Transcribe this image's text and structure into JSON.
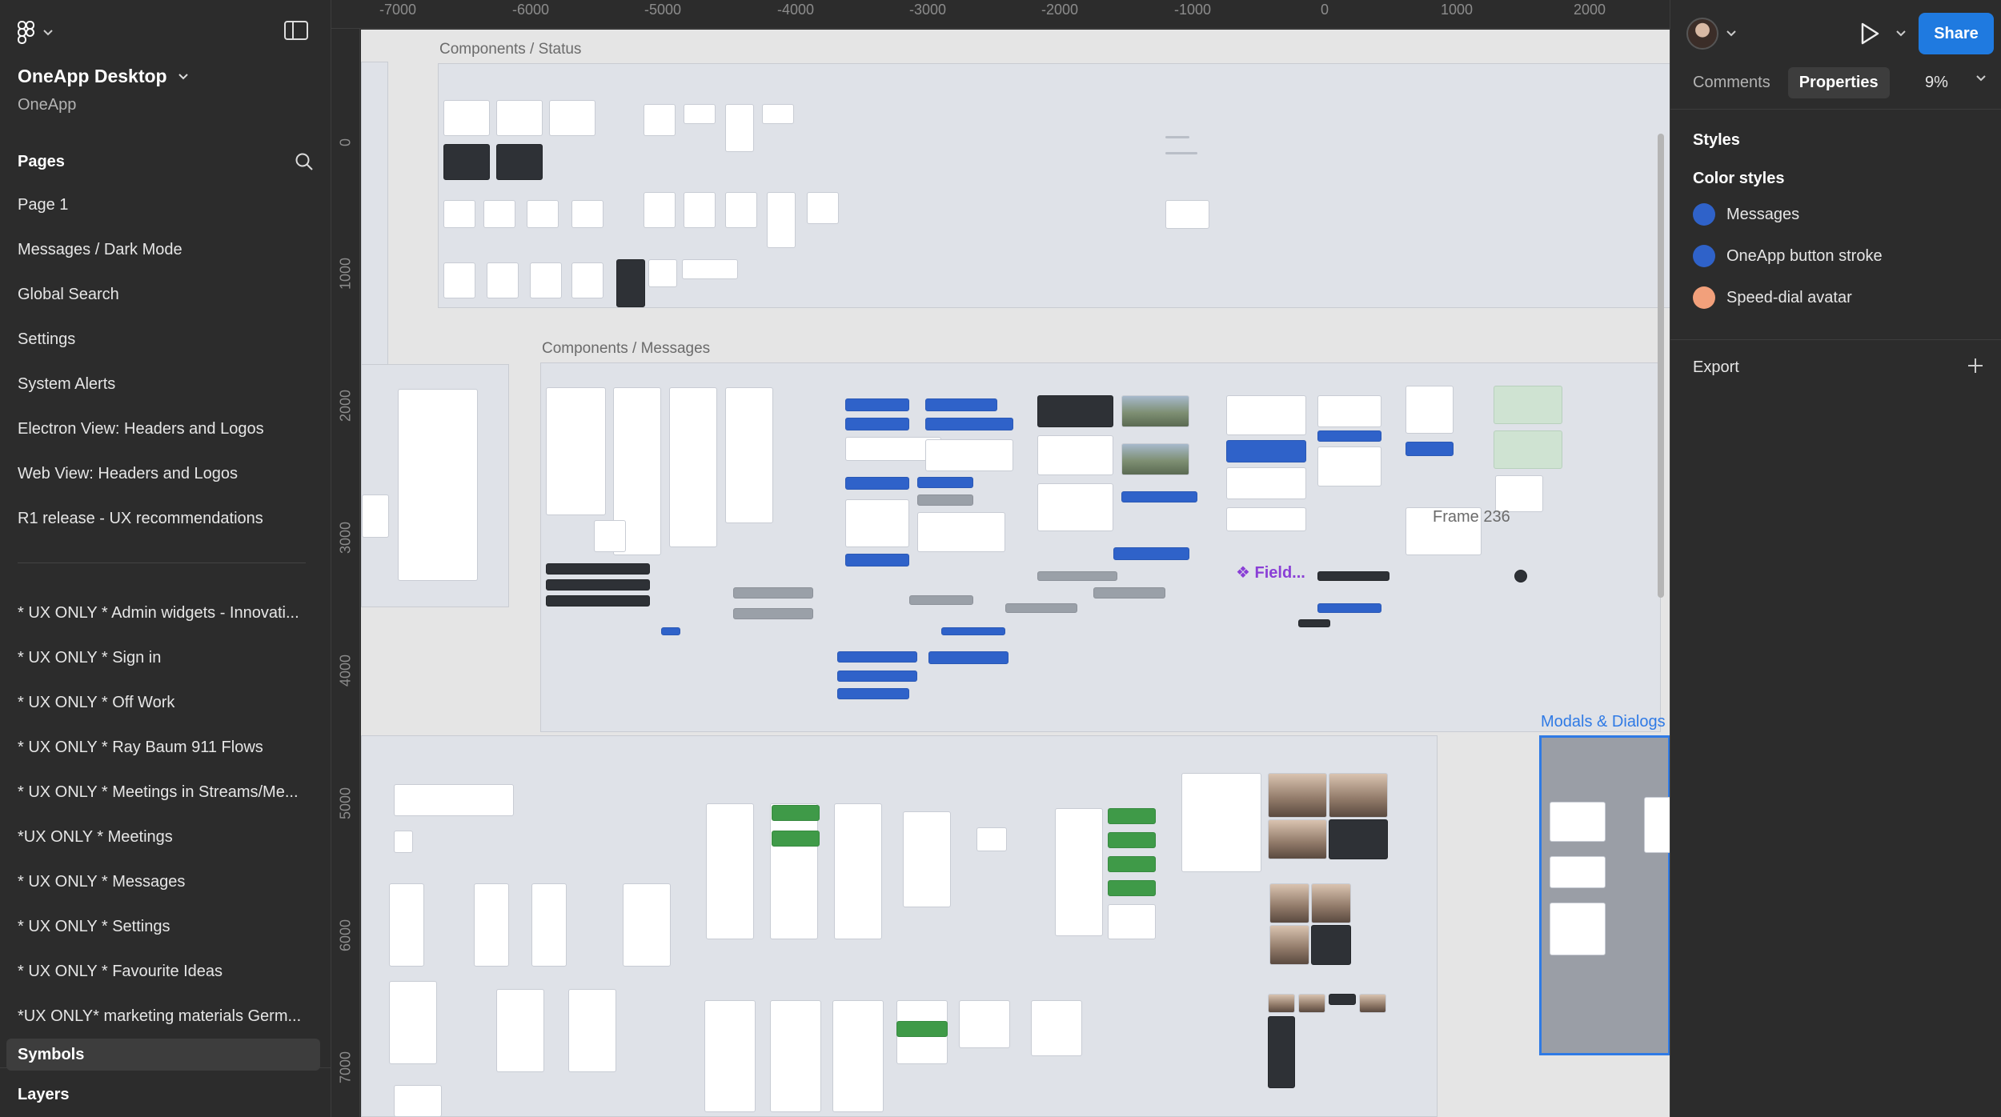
{
  "project": {
    "title": "OneApp Desktop",
    "subtitle": "OneApp"
  },
  "pages": {
    "header": "Pages",
    "group1": [
      "Page 1",
      "Messages / Dark Mode",
      "Global Search",
      "Settings",
      "System Alerts",
      "Electron View: Headers and Logos",
      "Web View: Headers and Logos",
      "R1 release - UX recommendations"
    ],
    "group2": [
      "* UX ONLY * Admin widgets - Innovati...",
      "* UX ONLY * Sign in",
      "* UX ONLY * Off Work",
      "* UX ONLY * Ray Baum 911 Flows",
      "* UX ONLY * Meetings in Streams/Me...",
      "*UX ONLY * Meetings",
      "* UX ONLY * Messages",
      "* UX ONLY * Settings",
      "* UX ONLY * Favourite Ideas",
      "*UX ONLY* marketing materials Germ..."
    ],
    "selected": "Symbols"
  },
  "layers": {
    "label": "Layers"
  },
  "ruler": {
    "top": [
      "-7000",
      "-6000",
      "-5000",
      "-4000",
      "-3000",
      "-2000",
      "-1000",
      "0",
      "1000",
      "2000"
    ],
    "left": [
      "0",
      "1000",
      "2000",
      "3000",
      "4000",
      "5000",
      "6000",
      "7000"
    ]
  },
  "canvas": {
    "frame_status": "Components / Status",
    "frame_messages": "Components / Messages",
    "frame_modals": "Modals & Dialogs",
    "frame_236": "Frame 236",
    "field_label": "Field..."
  },
  "right": {
    "share": "Share",
    "tabs": [
      "Comments",
      "Properties"
    ],
    "zoom": "9%",
    "styles_title": "Styles",
    "color_styles_title": "Color styles",
    "color_styles": [
      {
        "name": "Messages",
        "color": "#2f62c9"
      },
      {
        "name": "OneApp button stroke",
        "color": "#2f62c9"
      },
      {
        "name": "Speed-dial avatar",
        "color": "#f2a07b"
      }
    ],
    "export_title": "Export"
  },
  "icons": {
    "logo": "figma-logo-icon",
    "sidebar_toggle": "sidebar-toggle-icon",
    "search": "search-icon",
    "play": "play-icon",
    "add": "plus-icon"
  }
}
